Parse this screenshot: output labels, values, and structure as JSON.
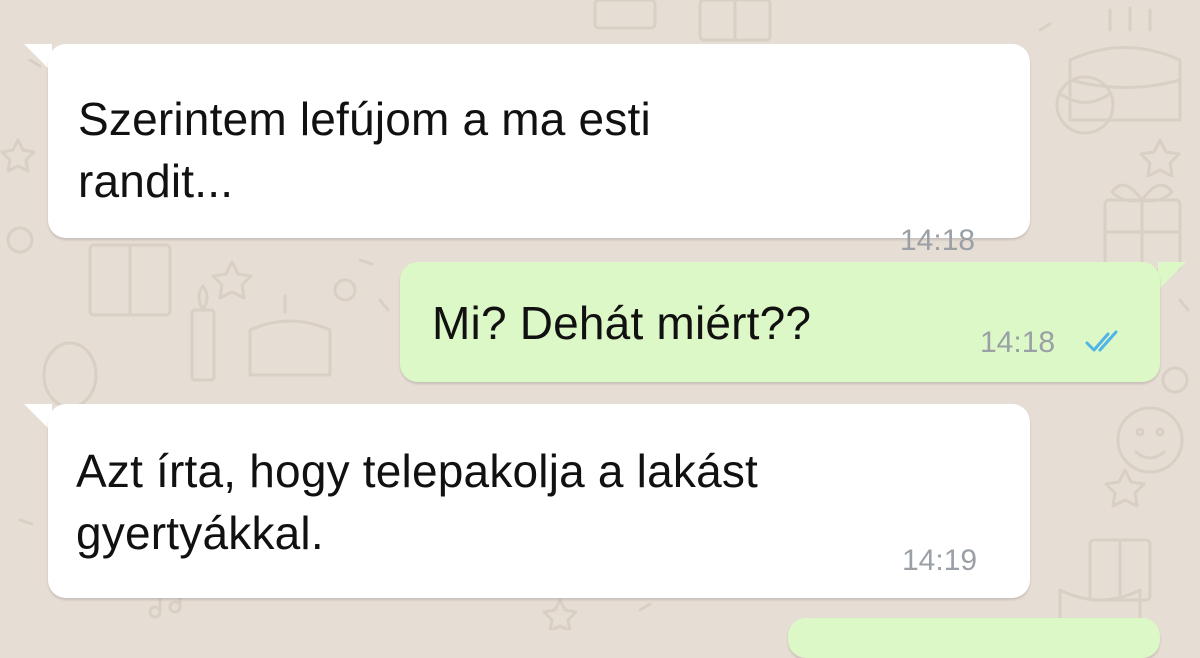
{
  "chat": {
    "messages": [
      {
        "direction": "incoming",
        "text": "Szerintem lefújom a ma esti\nrandit...",
        "time": "14:18"
      },
      {
        "direction": "outgoing",
        "text": "Mi? Dehát miért??",
        "time": "14:18",
        "status": "double-check-read-icon"
      },
      {
        "direction": "incoming",
        "text": "Azt írta, hogy telepakolja a lakást\ngyertyákkal.",
        "time": "14:19"
      },
      {
        "direction": "outgoing",
        "text": "",
        "time": ""
      }
    ]
  },
  "colors": {
    "wallpaper": "#e6ddd4",
    "incoming_bubble": "#ffffff",
    "outgoing_bubble": "#dcf8c6",
    "message_text": "#111111",
    "timestamp": "#9aa0a6",
    "read_ticks": "#4fb4e8"
  }
}
